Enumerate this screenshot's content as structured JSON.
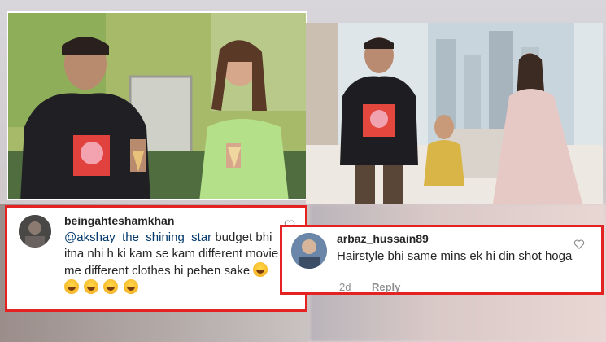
{
  "comments": [
    {
      "username": "beingahteshamkhan",
      "mention": "@akshay_the_shining_star",
      "text": " budget bhi itna nhi h ki kam se kam different movie me different clothes hi pehen sake",
      "emoji_count": 5
    },
    {
      "username": "arbaz_hussain89",
      "text": "Hairstyle bhi same mins ek hi din shot hoga",
      "time": "2d",
      "reply_label": "Reply"
    }
  ],
  "colors": {
    "highlight_border": "#e52222",
    "mention": "#00376b",
    "meta": "#8e8e8e"
  }
}
